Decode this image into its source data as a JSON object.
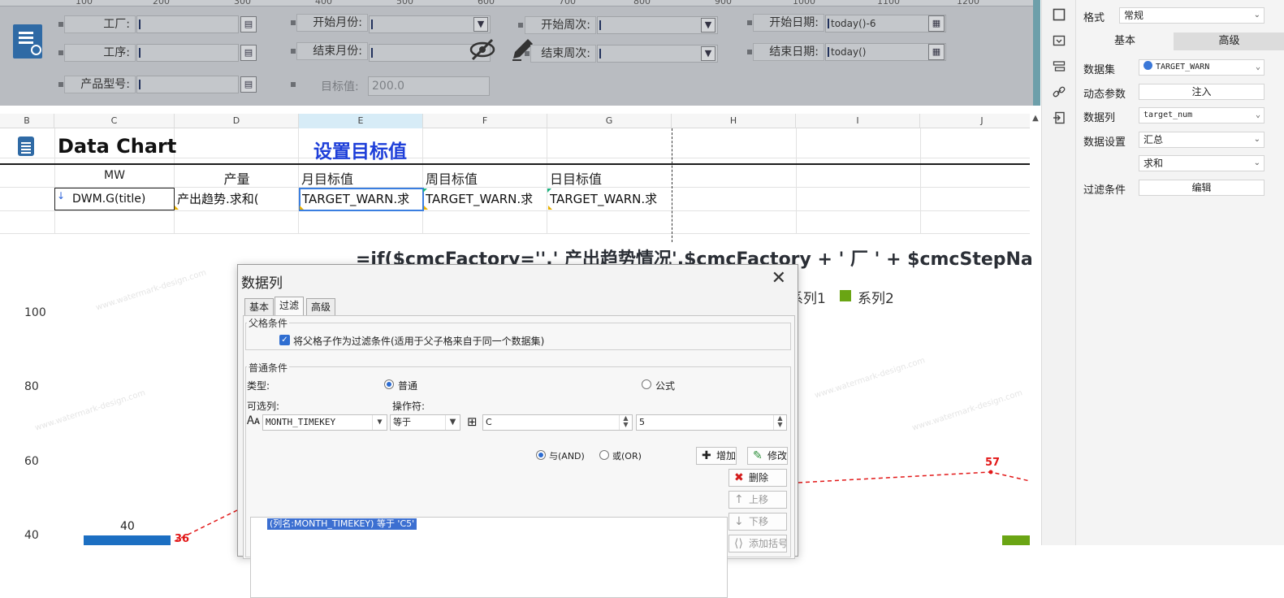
{
  "ruler": [
    "100",
    "200",
    "300",
    "400",
    "500",
    "600",
    "700",
    "800",
    "900",
    "1000",
    "1100",
    "1200"
  ],
  "params": {
    "factory_label": "工厂:",
    "step_label": "工序:",
    "product_label": "产品型号:",
    "start_month_label": "开始月份:",
    "end_month_label": "结束月份:",
    "target_label": "目标值:",
    "target_value": "200.0",
    "start_week_label": "开始周次:",
    "end_week_label": "结束周次:",
    "start_date_label": "开始日期:",
    "start_date_value": "today()-6",
    "end_date_label": "结束日期:",
    "end_date_value": "today()",
    "calendar_glyph": "▦",
    "picker_glyph": "▤",
    "dropdown_glyph": "▼"
  },
  "columns": [
    "B",
    "C",
    "D",
    "E",
    "F",
    "G",
    "H",
    "I",
    "J"
  ],
  "sheet": {
    "title": "Data Chart",
    "target_title": "设置目标值",
    "head_mw": "MW",
    "head_output": "产量",
    "head_month_target": "月目标值",
    "head_week_target": "周目标值",
    "head_day_target": "日目标值",
    "cell_mw": "DWM.G(title)",
    "cell_output": "产出趋势.求和(",
    "cell_month": "TARGET_WARN.求",
    "cell_week": "TARGET_WARN.求",
    "cell_day": "TARGET_WARN.求",
    "arrow_glyph": "↓"
  },
  "chart_formula": "=if($cmcFactory='',' 产出趋势情况',$cmcFactory + ' 厂 ' + $cmcStepNa",
  "chart_data": {
    "type": "bar",
    "title": "",
    "yticks": [
      "100",
      "80",
      "60",
      "40"
    ],
    "legend": [
      "系列1",
      "系列2"
    ],
    "data_labels": {
      "bar": "40",
      "line_start": "36",
      "line_peak": "57"
    },
    "series": [
      {
        "name": "系列1",
        "type": "bar",
        "color": "#1c6fc2"
      },
      {
        "name": "系列2",
        "type": "bar",
        "color": "#6aa514"
      }
    ],
    "line": {
      "color": "#e21818",
      "style": "dashed"
    }
  },
  "dialog": {
    "title": "数据列",
    "close_glyph": "✕",
    "tabs": [
      "基本",
      "过滤",
      "高级"
    ],
    "parent_group": "父格条件",
    "parent_check_label": "将父格子作为过滤条件(适用于父子格来自于同一个数据集)",
    "common_group": "普通条件",
    "type_label": "类型:",
    "type_normal": "普通",
    "type_formula": "公式",
    "column_label": "可选列:",
    "operator_label": "操作符:",
    "column_value": "MONTH_TIMEKEY",
    "operator_value": "等于",
    "value_text": "C",
    "value_text2": "5",
    "logic_and": "与(AND)",
    "logic_or": "或(OR)",
    "add_btn": "增加",
    "modify_btn": "修改",
    "delete_btn": "删除",
    "up_btn": "上移",
    "down_btn": "下移",
    "more_btn": "添加括号",
    "condition_item": "(列名:MONTH_TIMEKEY) 等于 'C5'",
    "check_glyph": "✓"
  },
  "props": {
    "format_label": "格式",
    "format_value": "常规",
    "tab_basic": "基本",
    "tab_advanced": "高级",
    "dataset_label": "数据集",
    "dataset_value": "TARGET_WARN",
    "dynamic_label": "动态参数",
    "dynamic_button": "注入",
    "column_label": "数据列",
    "column_value": "target_num",
    "setting_label": "数据设置",
    "setting_value": "汇总",
    "agg_value": "求和",
    "filter_label": "过滤条件",
    "filter_button": "编辑",
    "chevron": "⌄"
  },
  "colors": {
    "panel_bg": "#b9bcc1",
    "accent_blue": "#1e3fd9",
    "bar_blue": "#1c6fc2",
    "bar_green": "#6aa514",
    "line_red": "#e21818"
  }
}
